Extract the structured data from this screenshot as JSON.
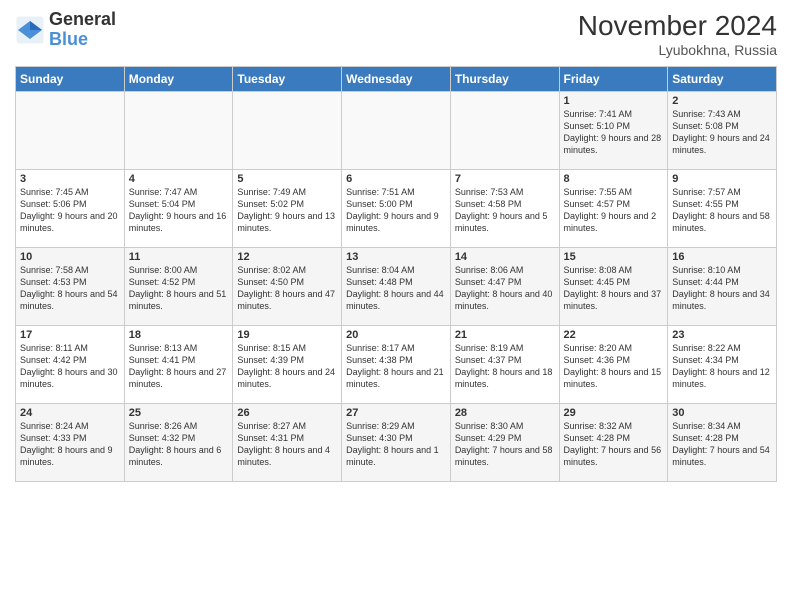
{
  "header": {
    "logo_line1": "General",
    "logo_line2": "Blue",
    "month": "November 2024",
    "location": "Lyubokhna, Russia"
  },
  "days_of_week": [
    "Sunday",
    "Monday",
    "Tuesday",
    "Wednesday",
    "Thursday",
    "Friday",
    "Saturday"
  ],
  "rows": [
    [
      {
        "day": "",
        "info": ""
      },
      {
        "day": "",
        "info": ""
      },
      {
        "day": "",
        "info": ""
      },
      {
        "day": "",
        "info": ""
      },
      {
        "day": "",
        "info": ""
      },
      {
        "day": "1",
        "info": "Sunrise: 7:41 AM\nSunset: 5:10 PM\nDaylight: 9 hours and 28 minutes."
      },
      {
        "day": "2",
        "info": "Sunrise: 7:43 AM\nSunset: 5:08 PM\nDaylight: 9 hours and 24 minutes."
      }
    ],
    [
      {
        "day": "3",
        "info": "Sunrise: 7:45 AM\nSunset: 5:06 PM\nDaylight: 9 hours and 20 minutes."
      },
      {
        "day": "4",
        "info": "Sunrise: 7:47 AM\nSunset: 5:04 PM\nDaylight: 9 hours and 16 minutes."
      },
      {
        "day": "5",
        "info": "Sunrise: 7:49 AM\nSunset: 5:02 PM\nDaylight: 9 hours and 13 minutes."
      },
      {
        "day": "6",
        "info": "Sunrise: 7:51 AM\nSunset: 5:00 PM\nDaylight: 9 hours and 9 minutes."
      },
      {
        "day": "7",
        "info": "Sunrise: 7:53 AM\nSunset: 4:58 PM\nDaylight: 9 hours and 5 minutes."
      },
      {
        "day": "8",
        "info": "Sunrise: 7:55 AM\nSunset: 4:57 PM\nDaylight: 9 hours and 2 minutes."
      },
      {
        "day": "9",
        "info": "Sunrise: 7:57 AM\nSunset: 4:55 PM\nDaylight: 8 hours and 58 minutes."
      }
    ],
    [
      {
        "day": "10",
        "info": "Sunrise: 7:58 AM\nSunset: 4:53 PM\nDaylight: 8 hours and 54 minutes."
      },
      {
        "day": "11",
        "info": "Sunrise: 8:00 AM\nSunset: 4:52 PM\nDaylight: 8 hours and 51 minutes."
      },
      {
        "day": "12",
        "info": "Sunrise: 8:02 AM\nSunset: 4:50 PM\nDaylight: 8 hours and 47 minutes."
      },
      {
        "day": "13",
        "info": "Sunrise: 8:04 AM\nSunset: 4:48 PM\nDaylight: 8 hours and 44 minutes."
      },
      {
        "day": "14",
        "info": "Sunrise: 8:06 AM\nSunset: 4:47 PM\nDaylight: 8 hours and 40 minutes."
      },
      {
        "day": "15",
        "info": "Sunrise: 8:08 AM\nSunset: 4:45 PM\nDaylight: 8 hours and 37 minutes."
      },
      {
        "day": "16",
        "info": "Sunrise: 8:10 AM\nSunset: 4:44 PM\nDaylight: 8 hours and 34 minutes."
      }
    ],
    [
      {
        "day": "17",
        "info": "Sunrise: 8:11 AM\nSunset: 4:42 PM\nDaylight: 8 hours and 30 minutes."
      },
      {
        "day": "18",
        "info": "Sunrise: 8:13 AM\nSunset: 4:41 PM\nDaylight: 8 hours and 27 minutes."
      },
      {
        "day": "19",
        "info": "Sunrise: 8:15 AM\nSunset: 4:39 PM\nDaylight: 8 hours and 24 minutes."
      },
      {
        "day": "20",
        "info": "Sunrise: 8:17 AM\nSunset: 4:38 PM\nDaylight: 8 hours and 21 minutes."
      },
      {
        "day": "21",
        "info": "Sunrise: 8:19 AM\nSunset: 4:37 PM\nDaylight: 8 hours and 18 minutes."
      },
      {
        "day": "22",
        "info": "Sunrise: 8:20 AM\nSunset: 4:36 PM\nDaylight: 8 hours and 15 minutes."
      },
      {
        "day": "23",
        "info": "Sunrise: 8:22 AM\nSunset: 4:34 PM\nDaylight: 8 hours and 12 minutes."
      }
    ],
    [
      {
        "day": "24",
        "info": "Sunrise: 8:24 AM\nSunset: 4:33 PM\nDaylight: 8 hours and 9 minutes."
      },
      {
        "day": "25",
        "info": "Sunrise: 8:26 AM\nSunset: 4:32 PM\nDaylight: 8 hours and 6 minutes."
      },
      {
        "day": "26",
        "info": "Sunrise: 8:27 AM\nSunset: 4:31 PM\nDaylight: 8 hours and 4 minutes."
      },
      {
        "day": "27",
        "info": "Sunrise: 8:29 AM\nSunset: 4:30 PM\nDaylight: 8 hours and 1 minute."
      },
      {
        "day": "28",
        "info": "Sunrise: 8:30 AM\nSunset: 4:29 PM\nDaylight: 7 hours and 58 minutes."
      },
      {
        "day": "29",
        "info": "Sunrise: 8:32 AM\nSunset: 4:28 PM\nDaylight: 7 hours and 56 minutes."
      },
      {
        "day": "30",
        "info": "Sunrise: 8:34 AM\nSunset: 4:28 PM\nDaylight: 7 hours and 54 minutes."
      }
    ]
  ]
}
